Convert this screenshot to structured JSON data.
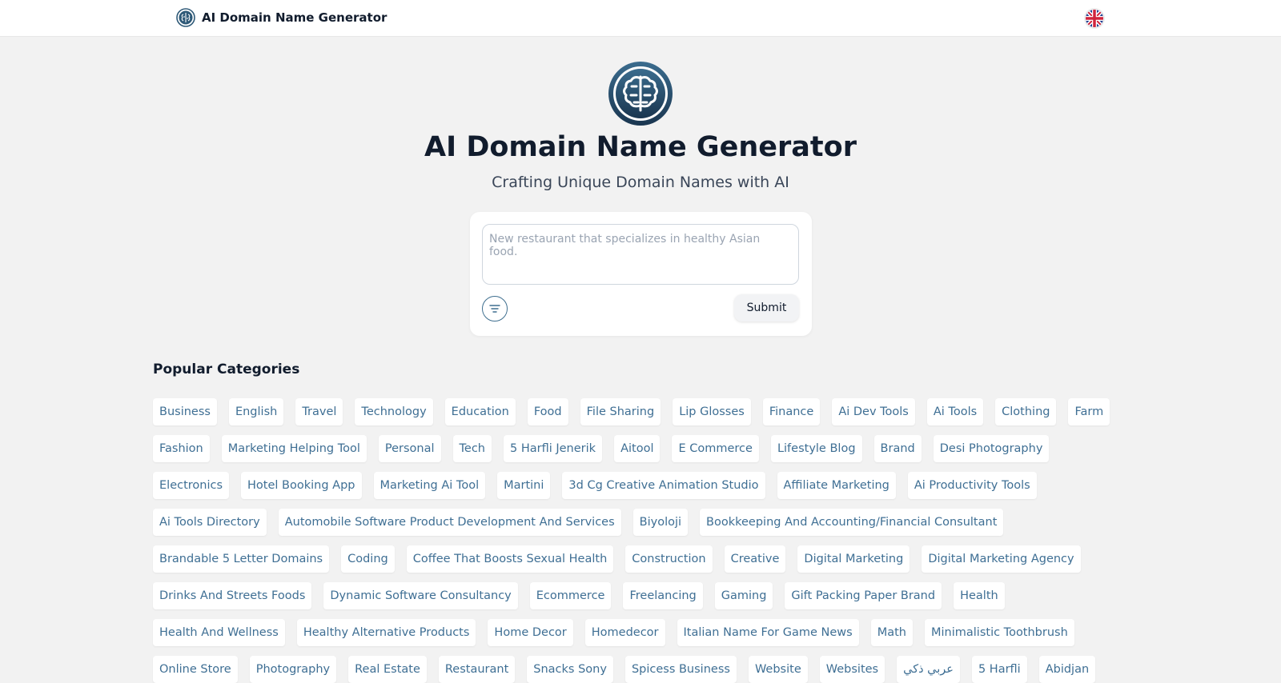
{
  "header": {
    "brand_name": "AI Domain Name Generator",
    "language_icon": "uk-flag-icon"
  },
  "hero": {
    "logo_icon": "brain-icon",
    "title": "AI Domain Name Generator",
    "subtitle": "Crafting Unique Domain Names with AI"
  },
  "form": {
    "placeholder": "New restaurant that specializes in healthy Asian food.",
    "value": "",
    "filter_icon": "filter-lines-icon",
    "submit_label": "Submit"
  },
  "categories": {
    "heading": "Popular Categories",
    "items": [
      "Business",
      "English",
      "Travel",
      "Technology",
      "Education",
      "Food",
      "File Sharing",
      "Lip Glosses",
      "Finance",
      "Ai Dev Tools",
      "Ai Tools",
      "Clothing",
      "Farm",
      "Fashion",
      "Marketing Helping Tool",
      "Personal",
      "Tech",
      "5 Harfli Jenerik",
      "Aitool",
      "E Commerce",
      "Lifestyle Blog",
      "Brand",
      "Desi Photography",
      "Electronics",
      "Hotel Booking App",
      "Marketing Ai Tool",
      "Martini",
      "3d Cg Creative Animation Studio",
      "Affiliate Marketing",
      "Ai Productivity Tools",
      "Ai Tools Directory",
      "Automobile Software Product Development And Services",
      "Biyoloji",
      "Bookkeeping And Accounting/Financial Consultant",
      "Brandable 5 Letter Domains",
      "Coding",
      "Coffee That Boosts Sexual Health",
      "Construction",
      "Creative",
      "Digital Marketing",
      "Digital Marketing Agency",
      "Drinks And Streets Foods",
      "Dynamic Software Consultancy",
      "Ecommerce",
      "Freelancing",
      "Gaming",
      "Gift Packing Paper Brand",
      "Health",
      "Health And Wellness",
      "Healthy Alternative Products",
      "Home Decor",
      "Homedecor",
      "Italian Name For Game News",
      "Math",
      "Minimalistic Toothbrush",
      "Online Store",
      "Photography",
      "Real Estate",
      "Restaurant",
      "Snacks Sony",
      "Spicess Business",
      "Website",
      "Websites",
      "عربي ذكي",
      "5 Harfli",
      "Abidjan"
    ]
  },
  "colors": {
    "accent": "#3f6f94",
    "logo_dark": "#1d3d56",
    "background": "#f2f2f2"
  }
}
